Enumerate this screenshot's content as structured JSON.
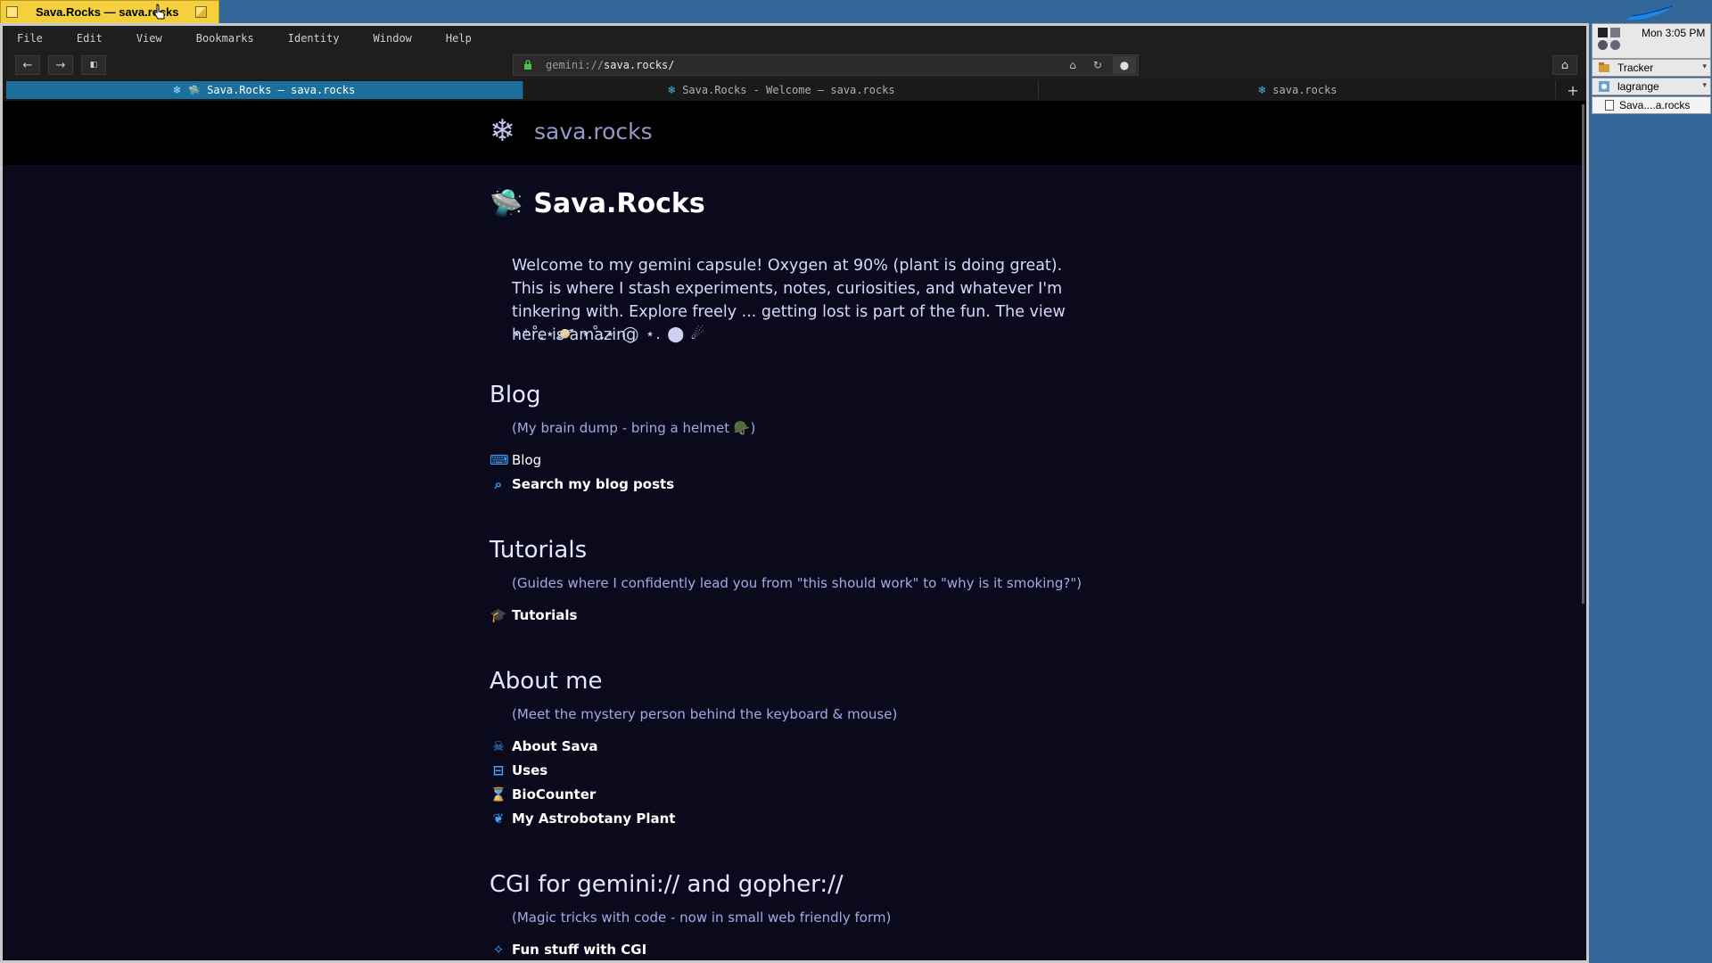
{
  "window_tab": {
    "title": "Sava.Rocks — sava.rocks"
  },
  "menu": [
    "File",
    "Edit",
    "View",
    "Bookmarks",
    "Identity",
    "Window",
    "Help"
  ],
  "address": {
    "scheme": "gemini://",
    "host": "sava.rocks/"
  },
  "tabs": [
    {
      "label": "Sava.Rocks — sava.rocks",
      "active": true
    },
    {
      "label": "Sava.Rocks - Welcome — sava.rocks",
      "active": false
    },
    {
      "label": "sava.rocks",
      "active": false
    }
  ],
  "page": {
    "site_name": "sava.rocks",
    "title": "Sava.Rocks",
    "intro": "Welcome to my gemini capsule! Oxygen at 90% (plant is doing great). This is where I stash experiments, notes, curiosities, and whatever I'm tinkering with. Explore freely ... getting lost is part of the fun. The view here is amazing",
    "stars_line": "⋆⁺˚.⋆🪐 ⋆˚.⋆ ◯ ⋆. ⬤ ☄",
    "sections": {
      "blog": {
        "heading": "Blog",
        "note": "(My brain dump - bring a helmet 🪖)",
        "links": [
          "Blog",
          "Search my blog posts"
        ]
      },
      "tutorials": {
        "heading": "Tutorials",
        "note": "(Guides where I confidently lead you from \"this should work\" to \"why is it smoking?\")",
        "links": [
          "Tutorials"
        ]
      },
      "about": {
        "heading": "About me",
        "note": "(Meet the mystery person behind the keyboard & mouse)",
        "links": [
          "About Sava",
          "Uses",
          "BioCounter",
          "My Astrobotany Plant"
        ]
      },
      "cgi": {
        "heading": "CGI for gemini:// and gopher://",
        "note": "(Magic tricks with code - now in small web friendly form)",
        "links": [
          "Fun stuff with CGI"
        ]
      }
    }
  },
  "dock": {
    "clock": "Mon 3:05 PM",
    "apps": [
      "Tracker",
      "lagrange"
    ],
    "window_item": "Sava....a.rocks"
  },
  "colors": {
    "page_bg": "#0b0a1c",
    "banner_bg": "#000000",
    "accent_tab": "#1b6f9c",
    "link_icon": "#3fa4ff",
    "desktop": "#336699",
    "window_tab": "#f4d03f"
  }
}
